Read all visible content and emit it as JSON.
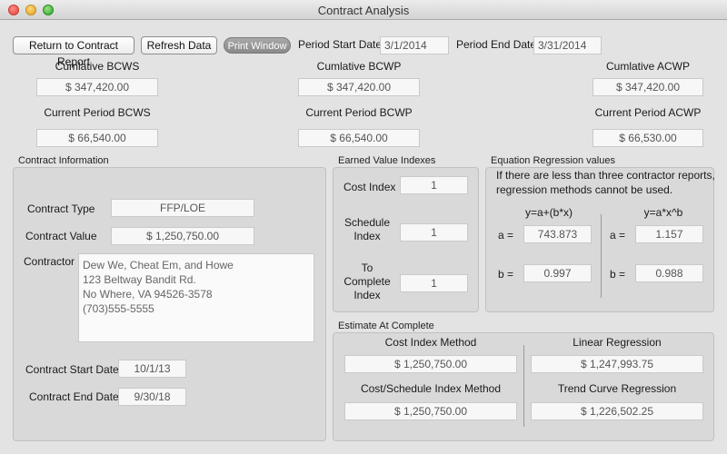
{
  "window": {
    "title": "Contract Analysis"
  },
  "toolbar": {
    "return_label": "Return to Contract Report",
    "refresh_label": "Refresh Data",
    "print_label": "Print Window",
    "period_start_label": "Period Start Date",
    "period_start_value": "3/1/2014",
    "period_end_label": "Period End Date",
    "period_end_value": "3/31/2014"
  },
  "summary": {
    "cum_bcws_label": "Cumlative BCWS",
    "cum_bcws_value": "$ 347,420.00",
    "cum_bcwp_label": "Cumlative BCWP",
    "cum_bcwp_value": "$ 347,420.00",
    "cum_acwp_label": "Cumlative ACWP",
    "cum_acwp_value": "$ 347,420.00",
    "cur_bcws_label": "Current Period BCWS",
    "cur_bcws_value": "$ 66,540.00",
    "cur_bcwp_label": "Current Period BCWP",
    "cur_bcwp_value": "$ 66,540.00",
    "cur_acwp_label": "Current Period ACWP",
    "cur_acwp_value": "$ 66,530.00"
  },
  "contract_info": {
    "title": "Contract Information",
    "type_label": "Contract Type",
    "type_value": "FFP/LOE",
    "value_label": "Contract Value",
    "value_value": "$ 1,250,750.00",
    "contractor_label": "Contractor",
    "contractor_lines": [
      "Dew We, Cheat Em, and Howe",
      "123 Beltway Bandit Rd.",
      "No Where, VA 94526-3578",
      "(703)555-5555"
    ],
    "start_label": "Contract Start Date",
    "start_value": "10/1/13",
    "end_label": "Contract End Date",
    "end_value": "9/30/18"
  },
  "ev_indexes": {
    "title": "Earned Value Indexes",
    "cost_label": "Cost Index",
    "cost_value": "1",
    "schedule_label_1": "Schedule",
    "schedule_label_2": "Index",
    "schedule_value": "1",
    "tc_label_1": "To",
    "tc_label_2": "Complete",
    "tc_label_3": "Index",
    "tc_value": "1"
  },
  "regression": {
    "title": "Equation Regression values",
    "note_1": "If there are less than three contractor reports,",
    "note_2": "regression methods cannot be used.",
    "linear_eq": "y=a+(b*x)",
    "curve_eq": "y=a*x^b",
    "a_label": "a =",
    "b_label": "b =",
    "linear_a": "743.873",
    "linear_b": "0.997",
    "curve_a": "1.157",
    "curve_b": "0.988"
  },
  "eac": {
    "title": "Estimate At Complete",
    "cost_index_label": "Cost Index Method",
    "cost_index_value": "$ 1,250,750.00",
    "cs_index_label": "Cost/Schedule Index Method",
    "cs_index_value": "$ 1,250,750.00",
    "linear_label": "Linear Regression",
    "linear_value": "$ 1,247,993.75",
    "trend_label": "Trend Curve Regression",
    "trend_value": "$ 1,226,502.25"
  }
}
